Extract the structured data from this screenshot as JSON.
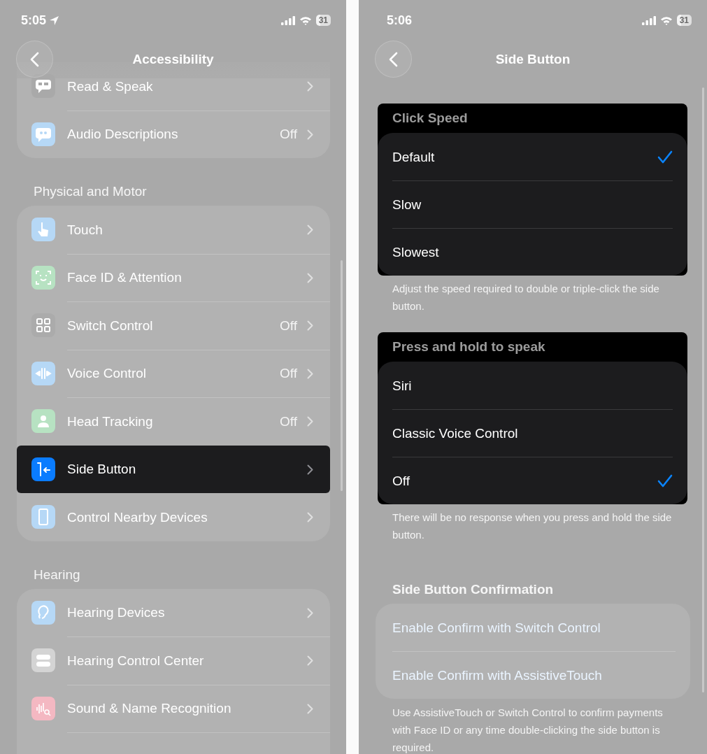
{
  "left_screen": {
    "status_bar": {
      "time": "5:05",
      "location_active": true,
      "battery": "31"
    },
    "nav": {
      "title": "Accessibility"
    },
    "sections": [
      {
        "more_above": true,
        "items": [
          {
            "label": "Read & Speak",
            "color": "#a9a9a9",
            "highlighted": false
          },
          {
            "label": "Audio Descriptions",
            "value": "Off",
            "color": "#b6d8f6",
            "highlighted": false
          }
        ]
      },
      {
        "header": "Physical and Motor",
        "items": [
          {
            "label": "Touch",
            "color": "#b6d8f6",
            "highlighted": false
          },
          {
            "label": "Face ID & Attention",
            "color": "#b7e2c2",
            "highlighted": false
          },
          {
            "label": "Switch Control",
            "value": "Off",
            "color": "#ababab",
            "highlighted": false
          },
          {
            "label": "Voice Control",
            "value": "Off",
            "color": "#b6d8f6",
            "highlighted": false
          },
          {
            "label": "Head Tracking",
            "value": "Off",
            "color": "#b7e2c2",
            "highlighted": false
          },
          {
            "label": "Side Button",
            "color": "#0a7cff",
            "highlighted": true
          },
          {
            "label": "Control Nearby Devices",
            "color": "#b6d8f6",
            "highlighted": false
          }
        ]
      },
      {
        "header": "Hearing",
        "more_below": true,
        "items": [
          {
            "label": "Hearing Devices",
            "color": "#b6d8f6",
            "highlighted": false
          },
          {
            "label": "Hearing Control Center",
            "color": "#d4d4d4",
            "highlighted": false
          },
          {
            "label": "Sound & Name Recognition",
            "color": "#f4b8c2",
            "highlighted": false
          }
        ]
      }
    ]
  },
  "right_screen": {
    "status_bar": {
      "time": "5:06",
      "battery": "31"
    },
    "nav": {
      "title": "Side Button"
    },
    "groups": [
      {
        "kind": "options",
        "highlighted": true,
        "header": "Click Speed",
        "options": [
          {
            "label": "Default",
            "selected": true
          },
          {
            "label": "Slow",
            "selected": false
          },
          {
            "label": "Slowest",
            "selected": false
          }
        ],
        "footer": "Adjust the speed required to double or triple-click the side button."
      },
      {
        "kind": "options",
        "highlighted": true,
        "header": "Press and hold to speak",
        "options": [
          {
            "label": "Siri",
            "selected": false
          },
          {
            "label": "Classic Voice Control",
            "selected": false
          },
          {
            "label": "Off",
            "selected": true
          }
        ],
        "footer": "There will be no response when you press and hold the side button."
      },
      {
        "kind": "links",
        "highlighted": false,
        "header": "Side Button Confirmation",
        "links": [
          "Enable Confirm with Switch Control",
          "Enable Confirm with AssistiveTouch"
        ],
        "footer": "Use AssistiveTouch or Switch Control to confirm payments with Face ID or any time double-clicking the side button is required."
      }
    ]
  }
}
